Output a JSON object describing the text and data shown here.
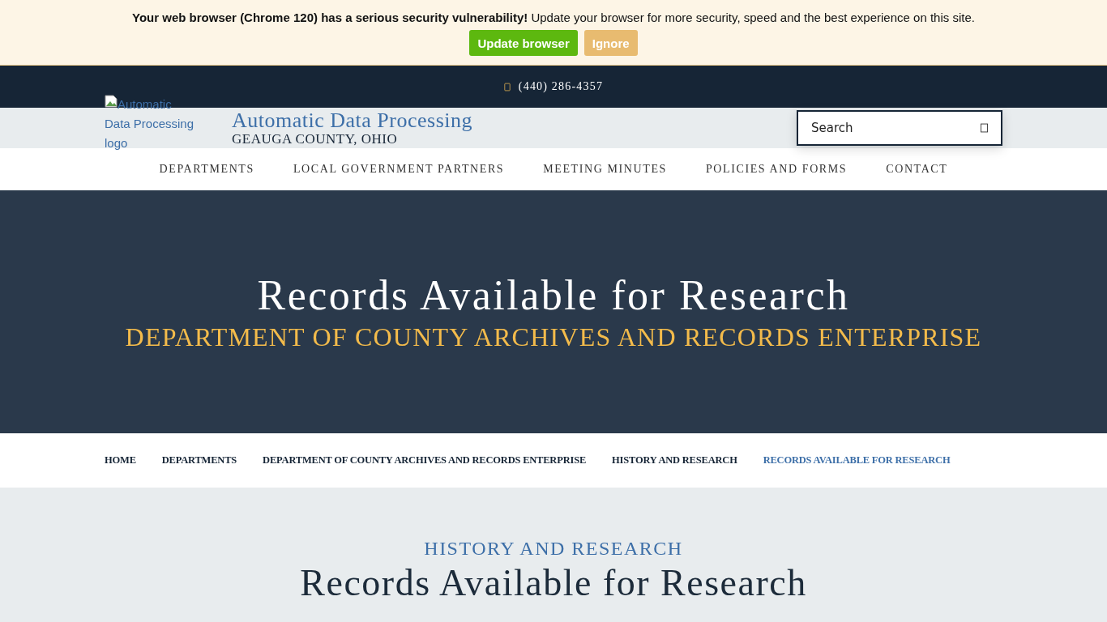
{
  "alert": {
    "message": "**Your web browser (Chrome 120) has a serious security vulnerability!** Update your browser for more security, speed and the best experience on this site.",
    "buttons": [
      {
        "label": "Update browser",
        "kind": "primary"
      },
      {
        "label": "Ignore",
        "kind": "secondary"
      }
    ]
  },
  "topbar": {
    "phone": "(440) 286-4357"
  },
  "header": {
    "logo_alt": "Automatic Data Processing logo",
    "site_title": "Automatic Data Processing",
    "site_subtitle": "GEAUGA COUNTY, OHIO",
    "search": {
      "placeholder": "Search"
    }
  },
  "nav": {
    "items": [
      "DEPARTMENTS",
      "LOCAL GOVERNMENT PARTNERS",
      "MEETING MINUTES",
      "POLICIES AND FORMS",
      "CONTACT"
    ]
  },
  "hero": {
    "title": "Records Available for Research",
    "subtitle": "DEPARTMENT OF COUNTY ARCHIVES AND RECORDS ENTERPRISE"
  },
  "breadcrumbs": [
    {
      "label": "HOME",
      "selected": false
    },
    {
      "label": "DEPARTMENTS",
      "selected": false
    },
    {
      "label": "DEPARTMENT OF COUNTY ARCHIVES AND RECORDS ENTERPRISE",
      "selected": false
    },
    {
      "label": "HISTORY AND RESEARCH",
      "selected": false
    },
    {
      "label": "RECORDS AVAILABLE FOR RESEARCH",
      "selected": true
    }
  ],
  "content": {
    "eyebrow": "HISTORY AND RESEARCH",
    "heading": "Records Available for Research"
  }
}
